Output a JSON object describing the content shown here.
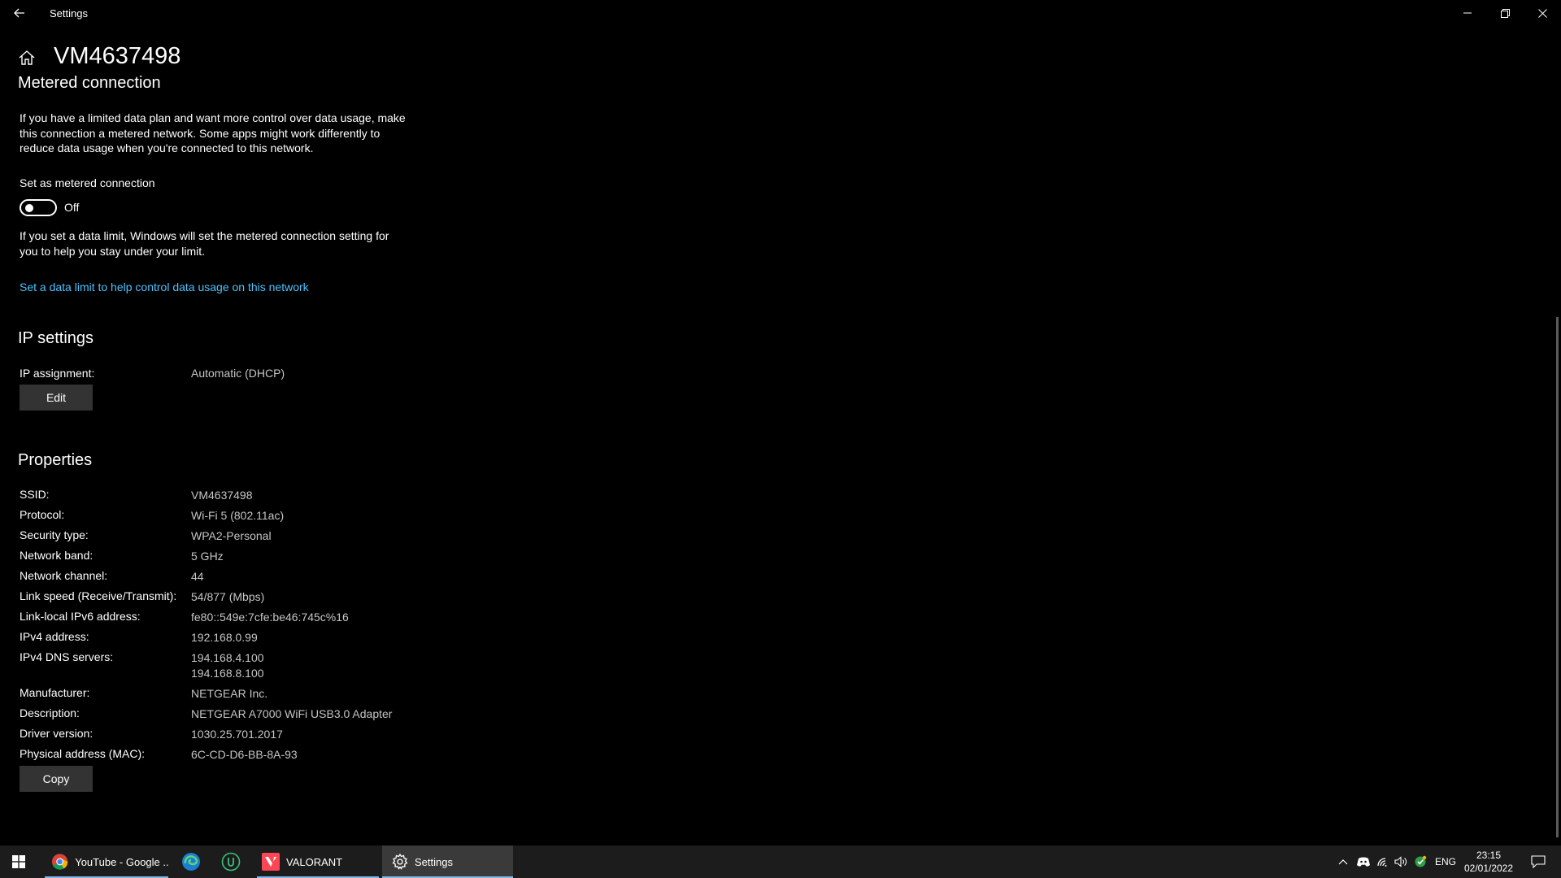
{
  "window": {
    "title": "Settings"
  },
  "header": {
    "page_title": "VM4637498"
  },
  "metered": {
    "heading": "Metered connection",
    "description": "If you have a limited data plan and want more control over data usage, make this connection a metered network. Some apps might work differently to reduce data usage when you're connected to this network.",
    "toggle_label": "Set as metered connection",
    "toggle_state": "Off",
    "data_limit_note": "If you set a data limit, Windows will set the metered connection setting for you to help you stay under your limit.",
    "data_limit_link": "Set a data limit to help control data usage on this network"
  },
  "ip_settings": {
    "heading": "IP settings",
    "assignment_label": "IP assignment:",
    "assignment_value": "Automatic (DHCP)",
    "edit_label": "Edit"
  },
  "properties": {
    "heading": "Properties",
    "rows": [
      {
        "label": "SSID:",
        "value": "VM4637498"
      },
      {
        "label": "Protocol:",
        "value": "Wi-Fi 5 (802.11ac)"
      },
      {
        "label": "Security type:",
        "value": "WPA2-Personal"
      },
      {
        "label": "Network band:",
        "value": "5 GHz"
      },
      {
        "label": "Network channel:",
        "value": "44"
      },
      {
        "label": "Link speed (Receive/Transmit):",
        "value": "54/877 (Mbps)"
      },
      {
        "label": "Link-local IPv6 address:",
        "value": "fe80::549e:7cfe:be46:745c%16"
      },
      {
        "label": "IPv4 address:",
        "value": "192.168.0.99"
      },
      {
        "label": "IPv4 DNS servers:",
        "value": "194.168.4.100",
        "value2": "194.168.8.100"
      },
      {
        "label": "Manufacturer:",
        "value": "NETGEAR Inc."
      },
      {
        "label": "Description:",
        "value": "NETGEAR A7000 WiFi USB3.0 Adapter"
      },
      {
        "label": "Driver version:",
        "value": "1030.25.701.2017"
      },
      {
        "label": "Physical address (MAC):",
        "value": "6C-CD-D6-BB-8A-93"
      }
    ],
    "copy_label": "Copy"
  },
  "taskbar": {
    "items": [
      {
        "label": "YouTube - Google ...",
        "icon": "chrome-icon"
      },
      {
        "label": "",
        "icon": "edge-icon"
      },
      {
        "label": "",
        "icon": "u-app-icon"
      },
      {
        "label": "VALORANT",
        "icon": "valorant-icon"
      },
      {
        "label": "Settings",
        "icon": "gear-icon"
      }
    ],
    "tray": {
      "language": "ENG",
      "time": "23:15",
      "date": "02/01/2022"
    }
  },
  "colors": {
    "background": "#000000",
    "accent_link": "#4cc2ff",
    "taskbar": "#1c1c1c"
  }
}
